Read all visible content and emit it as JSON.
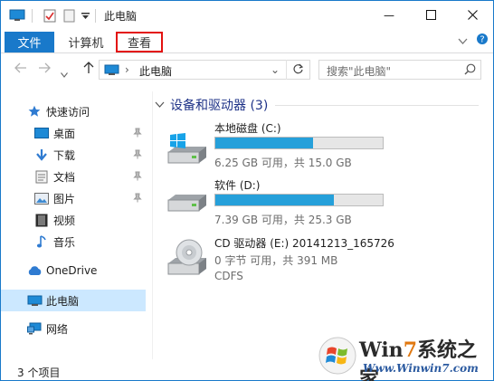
{
  "window": {
    "title": "此电脑",
    "controls": {
      "minimize": "—",
      "maximize": "☐",
      "close": "✕"
    }
  },
  "ribbon": {
    "tabs": [
      {
        "label": "文件",
        "active": true
      },
      {
        "label": "计算机"
      },
      {
        "label": "查看",
        "highlighted": true
      }
    ],
    "expand_icon": "chevron-down-icon",
    "help_icon": "help-icon"
  },
  "address": {
    "path": "此电脑",
    "search_placeholder": "搜索\"此电脑\""
  },
  "nav": {
    "quick_access": "快速访问",
    "items": [
      {
        "label": "桌面",
        "icon": "desktop-icon",
        "pinned": true
      },
      {
        "label": "下载",
        "icon": "download-icon",
        "pinned": true
      },
      {
        "label": "文档",
        "icon": "documents-icon",
        "pinned": true
      },
      {
        "label": "图片",
        "icon": "pictures-icon",
        "pinned": true
      },
      {
        "label": "视频",
        "icon": "videos-icon",
        "pinned": false
      },
      {
        "label": "音乐",
        "icon": "music-icon",
        "pinned": false
      }
    ],
    "onedrive": "OneDrive",
    "this_pc": "此电脑",
    "network": "网络"
  },
  "content": {
    "group_title": "设备和驱动器 (3)",
    "drives": [
      {
        "name": "本地磁盘 (C:)",
        "info": "6.25 GB 可用，共 15.0 GB",
        "used_fraction": 0.583,
        "icon": "windows-drive-icon"
      },
      {
        "name": "软件 (D:)",
        "info": "7.39 GB 可用，共 25.3 GB",
        "used_fraction": 0.708,
        "icon": "hard-drive-icon"
      },
      {
        "name": "CD 驱动器 (E:) 20141213_165726",
        "info": "0 字节 可用，共 391 MB",
        "fs": "CDFS",
        "icon": "cd-drive-icon"
      }
    ]
  },
  "status": {
    "items_count": "3 个项目"
  },
  "watermark": {
    "brand_prefix": "Win",
    "brand_seven": "7",
    "brand_suffix": "系统之家",
    "url": "Www.Winwin7.com"
  },
  "colors": {
    "accent": "#1979ca",
    "bar_fill": "#26a0da",
    "highlight": "#e3110f",
    "selected": "#cce8ff"
  }
}
